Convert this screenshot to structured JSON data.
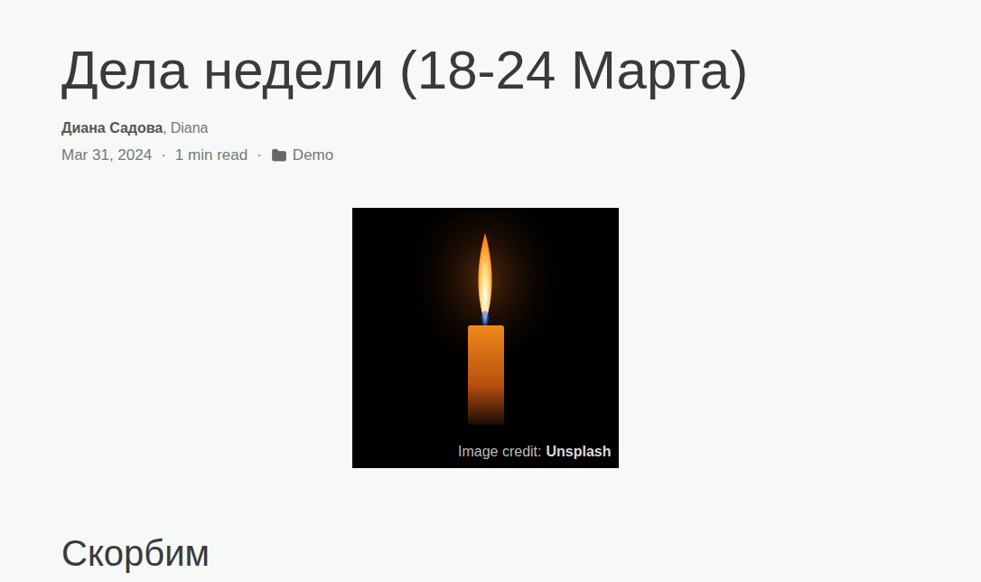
{
  "post": {
    "title": "Дела недели (18-24 Марта)",
    "authors": [
      "Диана Садова",
      "Diana"
    ],
    "author_separator": ",",
    "meta": {
      "date": "Mar 31, 2024",
      "separator": "·",
      "read_time": "1 min read",
      "category": "Demo"
    },
    "image": {
      "caption_prefix": "Image credit:",
      "caption_source": "Unsplash"
    },
    "section_heading": "Скорбим"
  }
}
